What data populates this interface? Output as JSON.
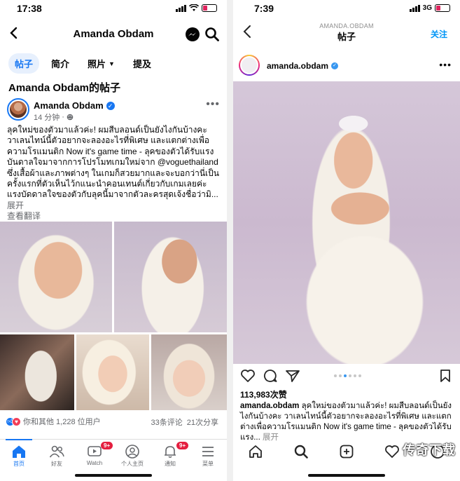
{
  "left": {
    "status": {
      "time": "17:38"
    },
    "header": {
      "title": "Amanda Obdam"
    },
    "tabs": [
      {
        "label": "帖子",
        "active": true
      },
      {
        "label": "简介",
        "active": false
      },
      {
        "label": "照片",
        "active": false,
        "dropdown": true
      },
      {
        "label": "提及",
        "active": false
      }
    ],
    "section_title": "Amanda Obdam的帖子",
    "post": {
      "author": "Amanda Obdam",
      "time": "14 分钟",
      "text": "ลุคใหม่ของตัวมาแล้วค่ะ! ผมสีบลอนด์เป็นยังไงกันบ้างคะ วาเลนไทน์นี้ตัวอยากจะลองอะไรที่พิเศษ และแตกต่างเพื่อความโรแมนติก Now it's game time - ลุคของตัวได้รับแรงบันดาลใจมาจากการโปรโมทเกมใหม่จาก @voguethailand ซึ่งเสื้อผ้าและภาพต่างๆ ในเกมก็สวยมากและจะบอกว่านี่เป็นครั้งแรกที่ตัวเห็นไว้กแนะนำคอนเทนต์เกี่ยวกับเกมเลยค่ะ แรงบัดดาลใจของตัวกับลุคนี้มาจากตัวละครสุดเจ้งชื่อว่ามิ...",
      "expand": "展开",
      "translate": "查看翻译",
      "reactions_text": "你和其他 1,228 位用户",
      "comments": "33条评论",
      "shares": "21次分享"
    },
    "nav": [
      {
        "label": "首页",
        "icon": "home-icon",
        "active": true
      },
      {
        "label": "好友",
        "icon": "friends-icon"
      },
      {
        "label": "Watch",
        "icon": "watch-icon",
        "badge": "9+"
      },
      {
        "label": "个人主页",
        "icon": "profile-icon"
      },
      {
        "label": "通知",
        "icon": "bell-icon",
        "badge": "9+"
      },
      {
        "label": "菜单",
        "icon": "menu-icon"
      }
    ]
  },
  "right": {
    "status": {
      "time": "7:39",
      "network": "3G"
    },
    "header": {
      "subtitle": "AMANDA.OBDAM",
      "title": "帖子",
      "follow": "关注"
    },
    "user": "amanda.obdam",
    "likes": "113,983次赞",
    "caption_user": "amanda.obdam",
    "caption": "ลุคใหม่ของตัวมาแล้วค่ะ! ผมสีบลอนด์เป็นยังไงกันบ้างคะ วาเลนไทน์นี้ตัวอยากจะลองอะไรที่พิเศษ และแตกต่างเพื่อความโรแมนติก Now it's game time - ลุคของตัวได้รับแรง...",
    "caption_more": "展开",
    "pager": {
      "count": 6,
      "current": 3
    },
    "watermark": "传奇下载"
  },
  "colors": {
    "fb_blue": "#1877f2",
    "ig_blue": "#0095f6",
    "badge_red": "#e41e3f"
  }
}
